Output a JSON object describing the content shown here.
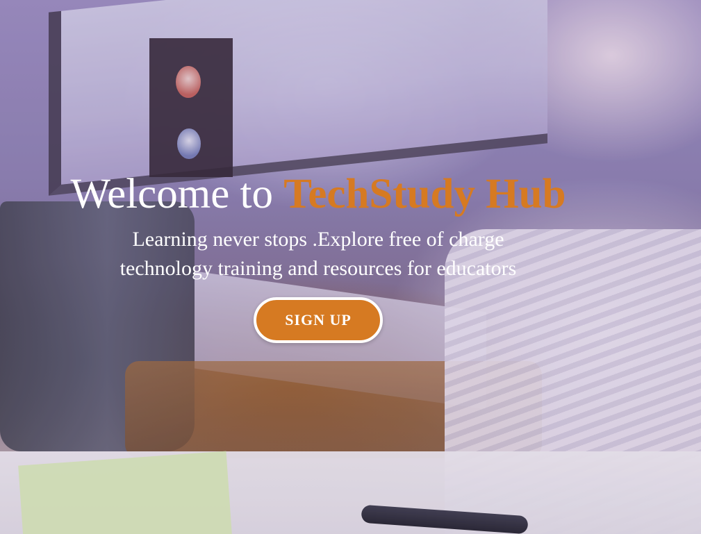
{
  "hero": {
    "title_prefix": "Welcome to ",
    "title_brand": "TechStudy Hub",
    "subtitle": "Learning never stops .Explore free of charge technology training and resources for educators",
    "signup_label": "SIGN UP"
  },
  "colors": {
    "accent": "#d67a22",
    "text": "#ffffff"
  }
}
